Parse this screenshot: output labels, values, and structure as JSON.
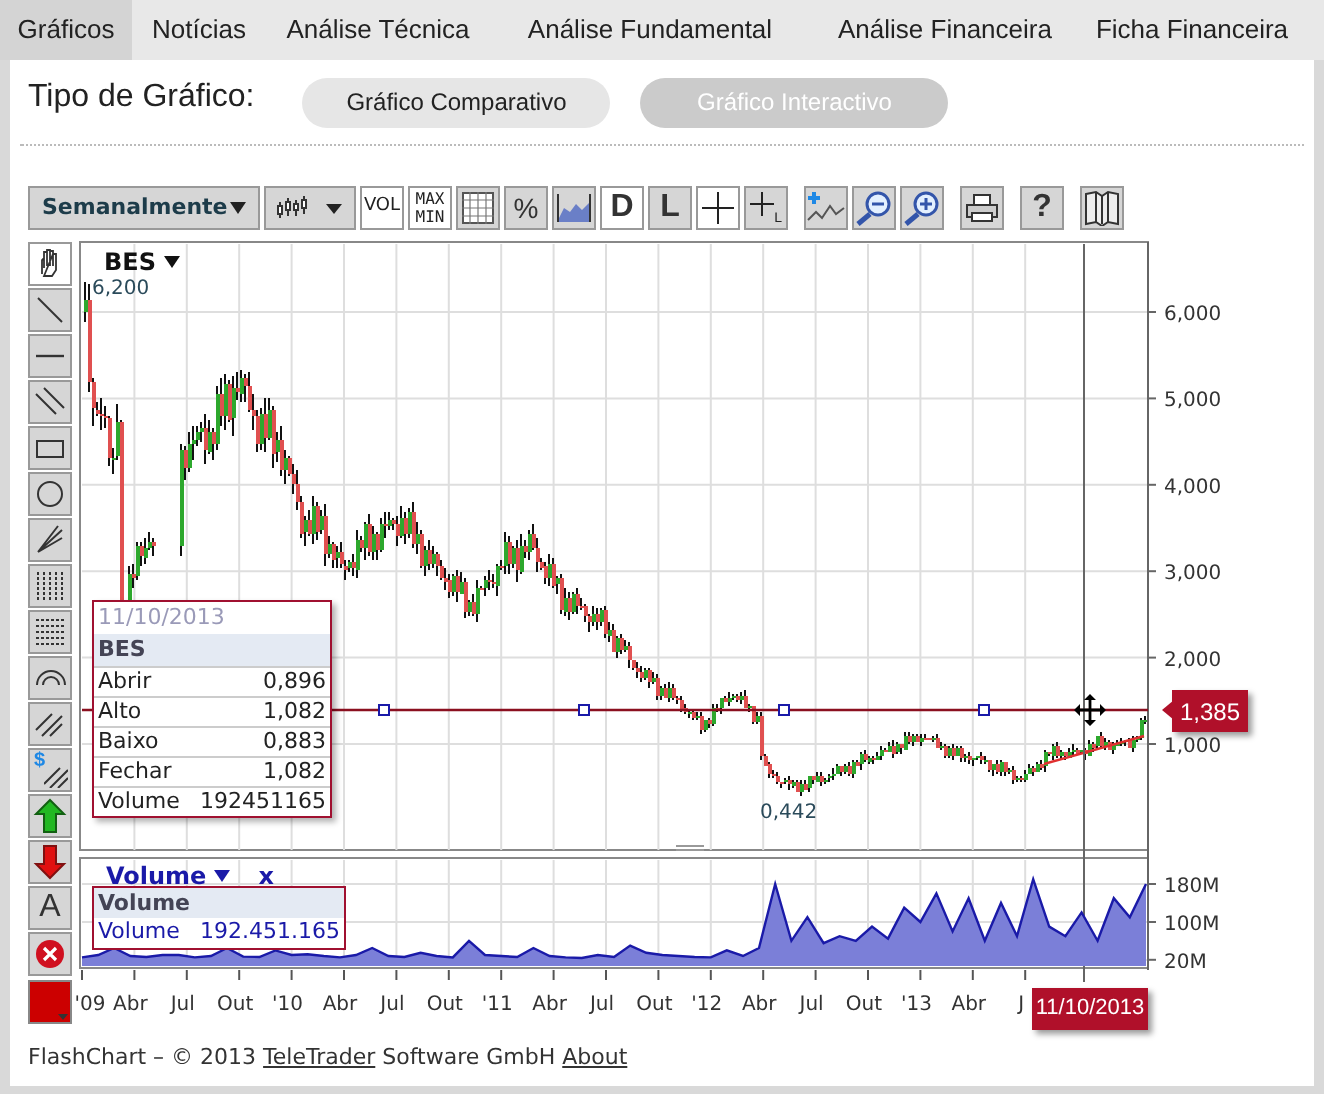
{
  "tabs": [
    {
      "label": "Gráficos",
      "selected": true
    },
    {
      "label": "Notícias",
      "selected": false
    },
    {
      "label": "Análise Técnica",
      "selected": false
    },
    {
      "label": "Análise Fundamental",
      "selected": false
    },
    {
      "label": "Análise Financeira",
      "selected": false
    },
    {
      "label": "Ficha Financeira",
      "selected": false
    }
  ],
  "chart_type": {
    "label": "Tipo de Gráfico:",
    "options": [
      {
        "label": "Gráfico Comparativo",
        "selected": false
      },
      {
        "label": "Gráfico Interactivo",
        "selected": true
      }
    ]
  },
  "toolbar": {
    "period": "Semanalmente",
    "buttons": [
      {
        "kind": "chart-type",
        "on": false
      },
      {
        "kind": "text",
        "label": "VOL",
        "on": true
      },
      {
        "kind": "maxmin",
        "label": "MAX",
        "label2": "MIN",
        "on": true
      },
      {
        "kind": "grid",
        "on": false
      },
      {
        "kind": "text",
        "label": "%",
        "on": false
      },
      {
        "kind": "area",
        "on": false
      },
      {
        "kind": "big-text",
        "label": "D",
        "on": true
      },
      {
        "kind": "big-text",
        "label": "L",
        "on": false
      },
      {
        "kind": "cross",
        "on": true
      },
      {
        "kind": "cross-sub",
        "label": "L",
        "on": false
      },
      {
        "kind": "indicator",
        "on": false
      },
      {
        "kind": "zoom-out",
        "on": false
      },
      {
        "kind": "zoom-in",
        "on": false
      },
      {
        "kind": "print",
        "on": false
      },
      {
        "kind": "big-text",
        "label": "?",
        "on": false
      },
      {
        "kind": "book",
        "on": false
      }
    ]
  },
  "tools": [
    {
      "kind": "hand",
      "selected": true
    },
    {
      "kind": "line",
      "selected": false
    },
    {
      "kind": "hline",
      "selected": false
    },
    {
      "kind": "parallel",
      "selected": false
    },
    {
      "kind": "rect",
      "selected": false
    },
    {
      "kind": "circle",
      "selected": false
    },
    {
      "kind": "fan",
      "selected": false
    },
    {
      "kind": "vlines",
      "selected": false
    },
    {
      "kind": "hlines",
      "selected": false
    },
    {
      "kind": "arc",
      "selected": false
    },
    {
      "kind": "diagonals",
      "selected": false
    },
    {
      "kind": "dollar",
      "label": "$",
      "selected": false
    },
    {
      "kind": "up",
      "selected": false
    },
    {
      "kind": "down",
      "selected": false
    },
    {
      "kind": "letter",
      "label": "A",
      "selected": false
    },
    {
      "kind": "delete",
      "selected": false
    }
  ],
  "price_panel": {
    "symbol": "BES",
    "high_label": "6,200",
    "low_label": "0,442",
    "y_ticks": [
      "6,000",
      "5,000",
      "4,000",
      "3,000",
      "2,000",
      "1,000"
    ],
    "cursor_price": "1,385",
    "tooltip": {
      "date": "11/10/2013",
      "symbol": "BES",
      "rows": [
        {
          "label": "Abrir",
          "value": "0,896"
        },
        {
          "label": "Alto",
          "value": "1,082"
        },
        {
          "label": "Baixo",
          "value": "0,883"
        },
        {
          "label": "Fechar",
          "value": "1,082"
        },
        {
          "label": "Volume",
          "value": "192451165"
        }
      ]
    }
  },
  "volume_panel": {
    "close": "x",
    "chart_data": {
      "type": "area",
      "ylim": [
        7,
        239
      ],
      "yticks": [
        {
          "value": 180,
          "label": "180M"
        },
        {
          "value": 100,
          "label": "100M"
        },
        {
          "value": 20,
          "label": "20M"
        }
      ],
      "series": [
        {
          "name": "Volume",
          "color": "#7b7fd8",
          "values": [
            25,
            30,
            45,
            28,
            26,
            30,
            30,
            25,
            28,
            45,
            27,
            26,
            40,
            30,
            32,
            28,
            25,
            30,
            45,
            28,
            26,
            35,
            28,
            25,
            60,
            30,
            28,
            26,
            45,
            28,
            25,
            24,
            30,
            26,
            50,
            35,
            30,
            28,
            26,
            25,
            40,
            28,
            45,
            180,
            60,
            110,
            55,
            70,
            60,
            90,
            65,
            130,
            100,
            160,
            80,
            150,
            60,
            140,
            70,
            190,
            90,
            70,
            120,
            60,
            150,
            110,
            180
          ]
        }
      ]
    },
    "tooltip": {
      "title": "Volume",
      "label": "Volume",
      "value": "192.451.165"
    }
  },
  "x_axis": {
    "labels": [
      "'09",
      "Abr",
      "Jul",
      "Out",
      "'10",
      "Abr",
      "Jul",
      "Out",
      "'11",
      "Abr",
      "Jul",
      "Out",
      "'12",
      "Abr",
      "Jul",
      "Out",
      "'13",
      "Abr",
      "J"
    ],
    "cursor_date": "11/10/2013"
  },
  "footer": {
    "prefix": "FlashChart – © 2013",
    "company": "TeleTrader",
    "suffix": "Software GmbH",
    "about": "About"
  }
}
